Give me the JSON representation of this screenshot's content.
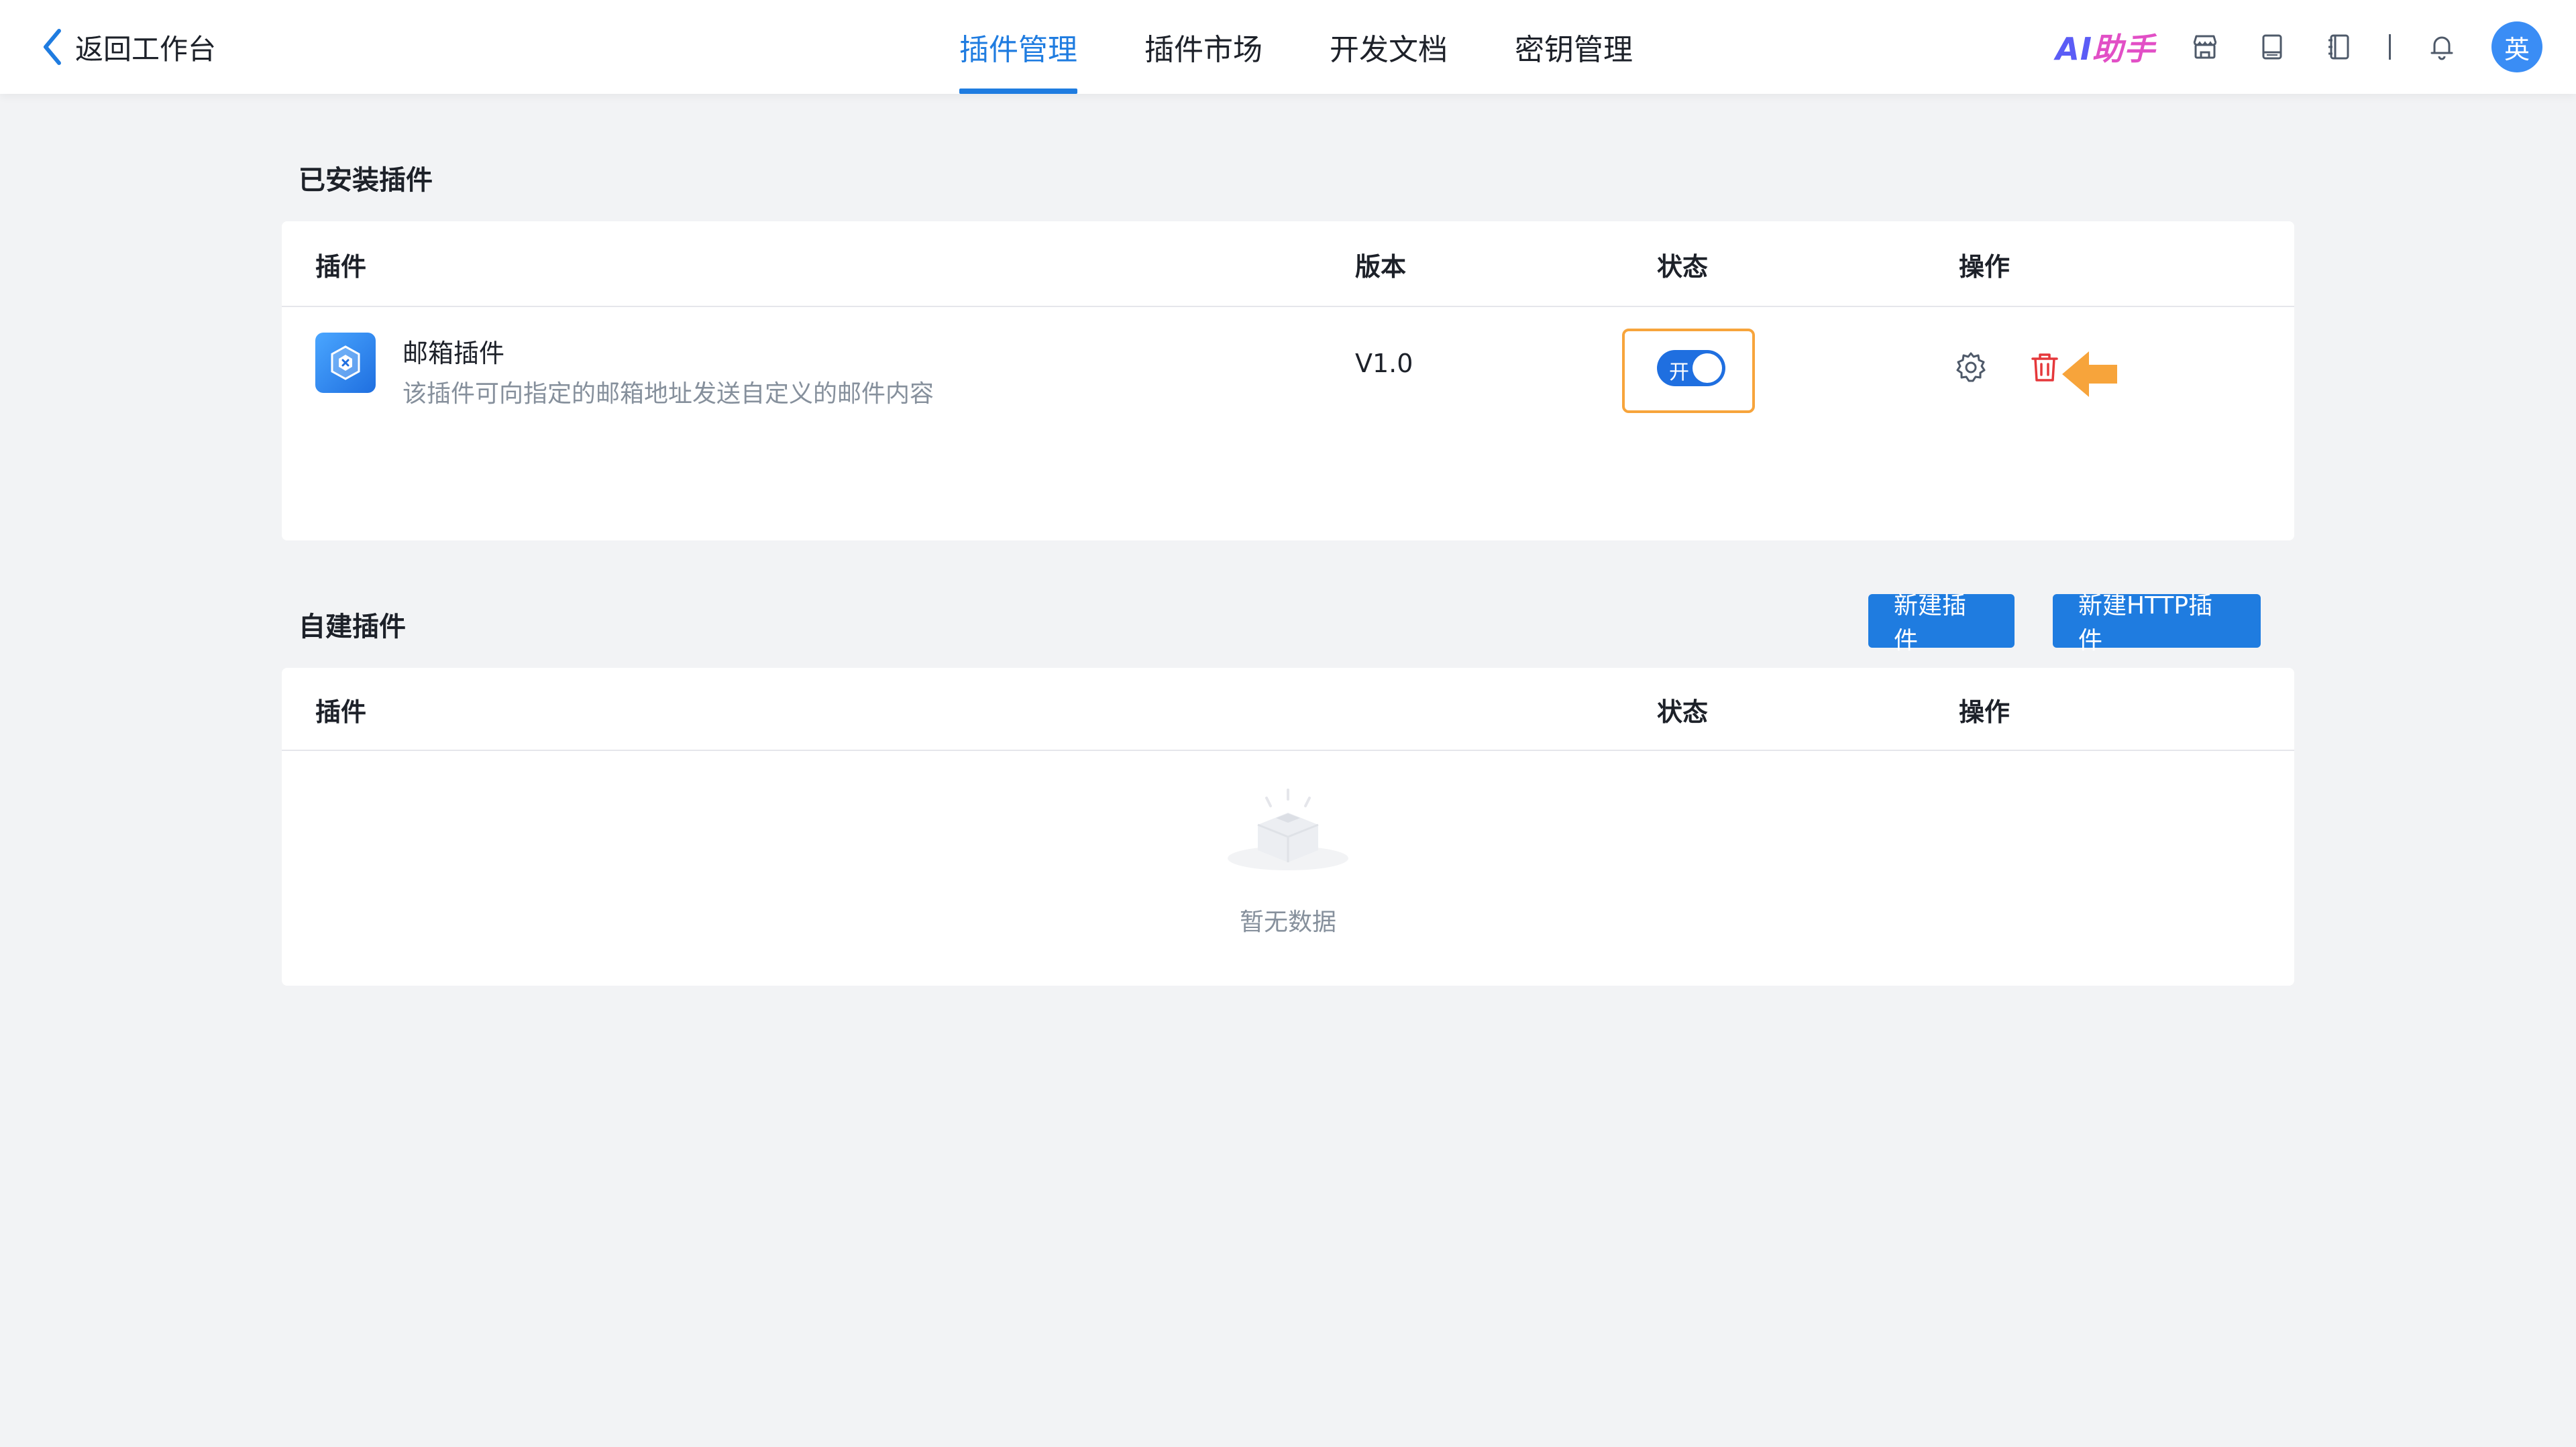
{
  "header": {
    "back_label": "返回工作台",
    "tabs": [
      {
        "label": "插件管理",
        "active": true
      },
      {
        "label": "插件市场",
        "active": false
      },
      {
        "label": "开发文档",
        "active": false
      },
      {
        "label": "密钥管理",
        "active": false
      }
    ],
    "ai_logo": "AI助手",
    "tool_icons": [
      "store-icon",
      "book-icon",
      "notebook-icon"
    ],
    "avatar_text": "英"
  },
  "installed": {
    "title": "已安装插件",
    "columns": {
      "plugin": "插件",
      "version": "版本",
      "status": "状态",
      "action": "操作"
    },
    "rows": [
      {
        "name": "邮箱插件",
        "description": "该插件可向指定的邮箱地址发送自定义的邮件内容",
        "version": "V1.0",
        "status_label": "开",
        "enabled": true
      }
    ]
  },
  "custom": {
    "title": "自建插件",
    "new_button": "新建插件",
    "new_http_button": "新建HTTP插件",
    "columns": {
      "plugin": "插件",
      "status": "状态",
      "action": "操作"
    },
    "empty_text": "暂无数据"
  },
  "colors": {
    "accent": "#1f7ce0",
    "highlight": "#f7a43b",
    "danger": "#e5383b"
  }
}
